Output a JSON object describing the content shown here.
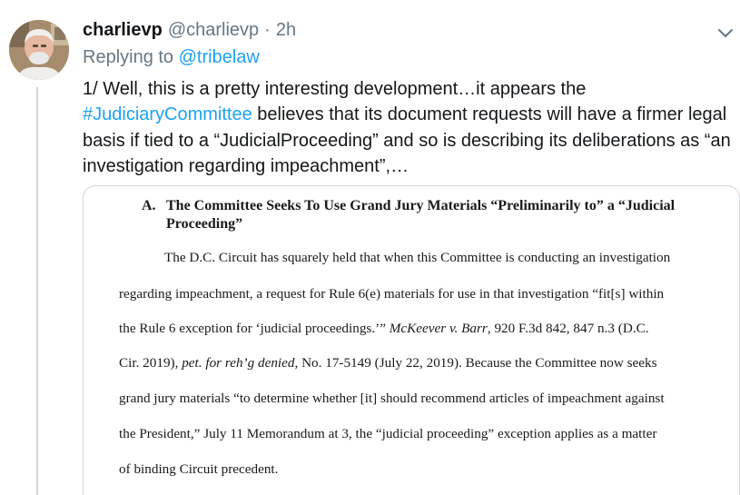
{
  "tweet": {
    "display_name": "charlievp",
    "handle": "@charlievp",
    "separator": "·",
    "time": "2h",
    "replying_prefix": "Replying to ",
    "replying_to": "@tribelaw",
    "text_part1": "1/ Well, this is a pretty interesting development…it appears the ",
    "hashtag": "#JudiciaryCommittee",
    "text_part2": " believes that its document requests will have a firmer legal basis if tied to a “JudicialProceeding” and so is describing its deliberations as “an investigation regarding impeachment”,…"
  },
  "document": {
    "heading_letter": "A.",
    "heading_text": "The Committee Seeks To Use Grand Jury Materials “Preliminarily to” a “Judicial Proceeding”",
    "line1": "The D.C. Circuit has squarely held that when this Committee is conducting an investigation",
    "line2": "regarding impeachment, a request for Rule 6(e) materials for use in that investigation “fit[s] within",
    "line3_a": "the Rule 6 exception for ‘judicial proceedings.’”  ",
    "line3_italic": "McKeever v. Barr",
    "line3_b": ", 920 F.3d 842, 847 n.3 (D.C.",
    "line4_a": "Cir. 2019), ",
    "line4_italic": "pet. for reh’g denied",
    "line4_b": ", No. 17-5149 (July 22, 2019).  Because the Committee now seeks",
    "line5": "grand jury materials “to determine whether [it] should recommend articles of impeachment against",
    "line6": "the President,” July 11 Memorandum at 3, the “judicial proceeding” exception applies as a matter",
    "line7": "of binding Circuit precedent."
  },
  "colors": {
    "link": "#1da1f2",
    "secondary_text": "#657786",
    "primary_text": "#14171a",
    "border": "#ccd6dd"
  },
  "icons": {
    "menu": "chevron-down-icon"
  }
}
